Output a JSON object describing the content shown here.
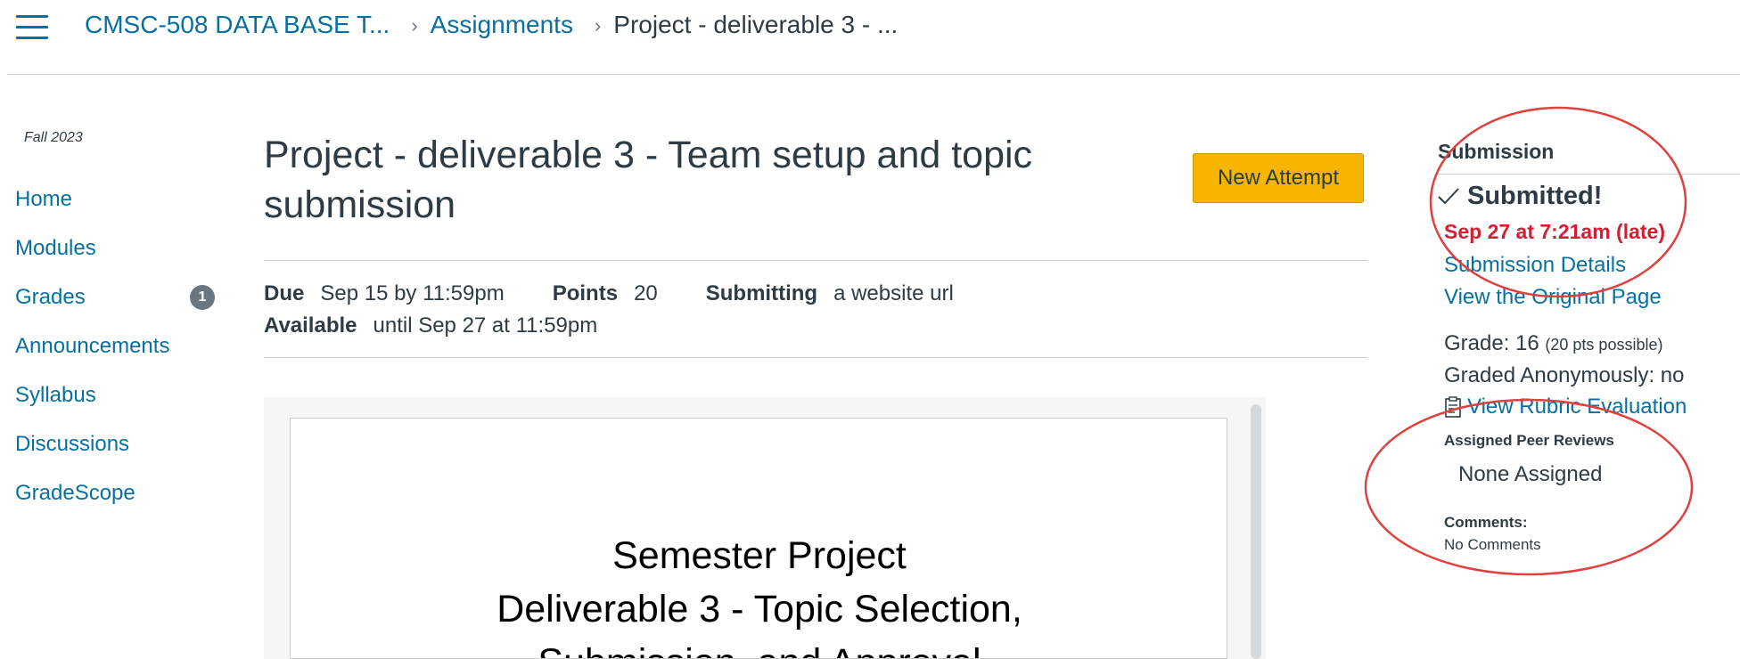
{
  "header": {
    "course": "CMSC-508 DATA BASE T...",
    "assignments": "Assignments",
    "current": "Project - deliverable 3 - ..."
  },
  "sidebar": {
    "term": "Fall 2023",
    "items": [
      {
        "label": "Home"
      },
      {
        "label": "Modules"
      },
      {
        "label": "Grades",
        "badge": "1"
      },
      {
        "label": "Announcements"
      },
      {
        "label": "Syllabus"
      },
      {
        "label": "Discussions"
      },
      {
        "label": "GradeScope"
      }
    ]
  },
  "assignment": {
    "title": "Project - deliverable 3 - Team setup and topic submission",
    "new_attempt": "New Attempt",
    "due_label": "Due",
    "due_value": "Sep 15 by 11:59pm",
    "points_label": "Points",
    "points_value": "20",
    "submitting_label": "Submitting",
    "submitting_value": "a website url",
    "available_label": "Available",
    "available_value": "until Sep 27 at 11:59pm"
  },
  "preview": {
    "line1": "Semester Project",
    "line2": "Deliverable 3 - Topic Selection,",
    "line3": "Submission, and Approval"
  },
  "submission": {
    "heading": "Submission",
    "status": "Submitted!",
    "date": "Sep 27 at 7:21am (late)",
    "details_link": "Submission Details",
    "original_link": "View the Original Page",
    "grade_label": "Grade: 16",
    "grade_possible": "(20 pts possible)",
    "graded_anon": "Graded Anonymously: no",
    "rubric_link": "View Rubric Evaluation",
    "peer_heading": "Assigned Peer Reviews",
    "peer_value": "None Assigned",
    "comments_heading": "Comments:",
    "comments_value": "No Comments"
  },
  "colors": {
    "link": "#0770a3",
    "accent_button": "#f7b500",
    "late": "#d41e34",
    "annotation": "#e0403e"
  },
  "icons": [
    "hamburger-icon",
    "chevron-right-icon",
    "check-icon",
    "rubric-icon"
  ]
}
